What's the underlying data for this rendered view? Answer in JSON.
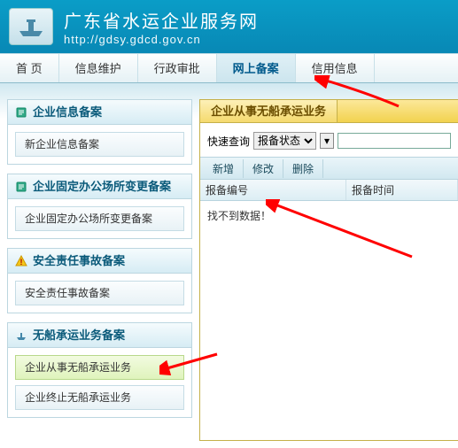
{
  "header": {
    "title": "广东省水运企业服务网",
    "url": "http://gdsy.gdcd.gov.cn"
  },
  "nav": {
    "items": [
      {
        "label": "首 页"
      },
      {
        "label": "信息维护"
      },
      {
        "label": "行政审批"
      },
      {
        "label": "网上备案"
      },
      {
        "label": "信用信息"
      }
    ],
    "activeIndex": 3
  },
  "sidebar": {
    "panels": [
      {
        "title": "企业信息备案",
        "icon": "note-icon",
        "items": [
          {
            "label": "新企业信息备案"
          }
        ]
      },
      {
        "title": "企业固定办公场所变更备案",
        "icon": "note-icon",
        "items": [
          {
            "label": "企业固定办公场所变更备案"
          }
        ]
      },
      {
        "title": "安全责任事故备案",
        "icon": "warning-icon",
        "items": [
          {
            "label": "安全责任事故备案"
          }
        ]
      },
      {
        "title": "无船承运业务备案",
        "icon": "ship-icon",
        "items": [
          {
            "label": "企业从事无船承运业务",
            "selected": true
          },
          {
            "label": "企业终止无船承运业务"
          }
        ]
      }
    ]
  },
  "main": {
    "tab_label": "企业从事无船承运业务",
    "filter": {
      "label": "快速查询",
      "select_value": "报备状态"
    },
    "toolbar": {
      "add": "新增",
      "edit": "修改",
      "del": "删除"
    },
    "grid": {
      "col1": "报备编号",
      "col2": "报备时间",
      "empty": "找不到数据！"
    }
  }
}
